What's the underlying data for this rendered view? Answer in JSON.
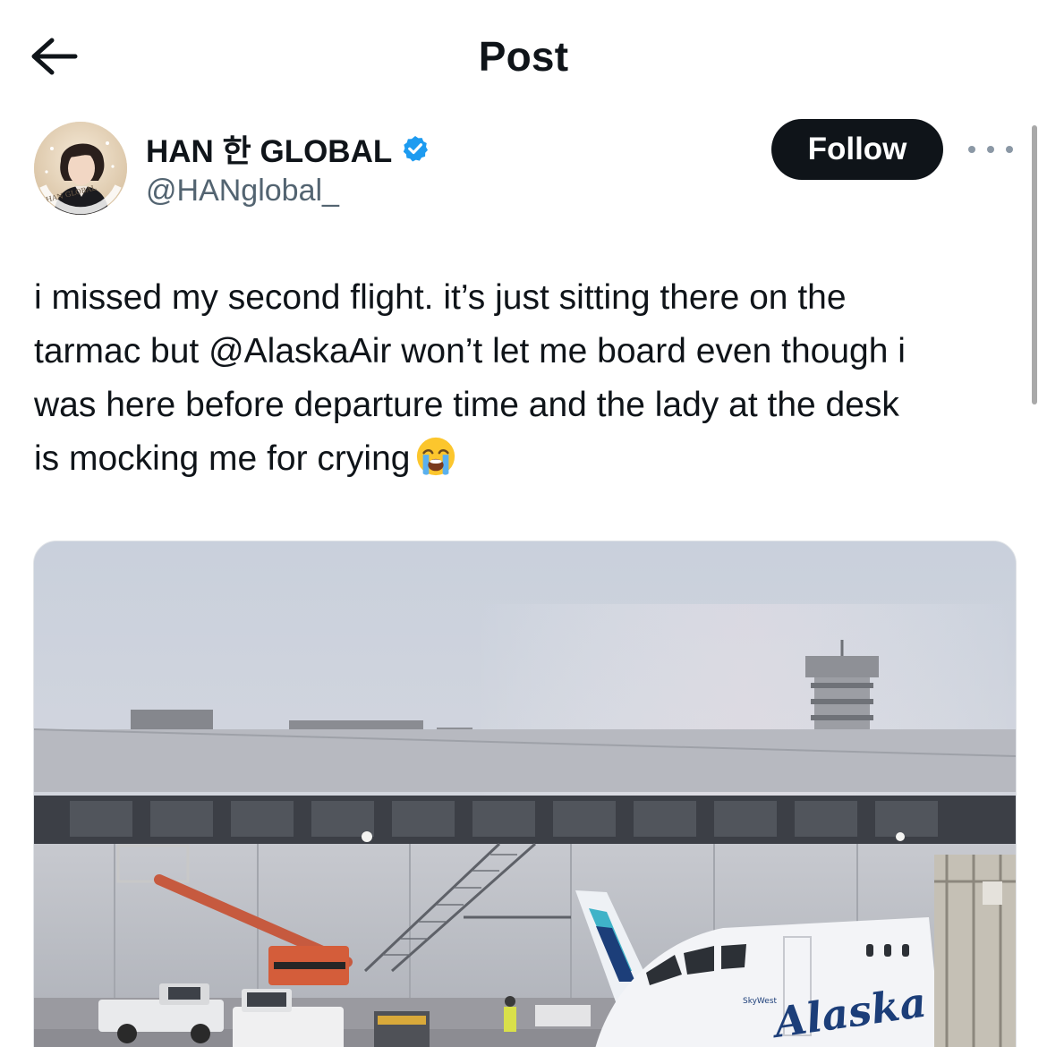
{
  "header": {
    "title": "Post",
    "back_icon": "arrow-left-icon"
  },
  "author": {
    "name": "HAN 한 GLOBAL",
    "handle": "@HANglobal_",
    "verified_icon": "verified-badge-icon",
    "avatar_text": "HAN GLOBAL"
  },
  "actions": {
    "follow_label": "Follow",
    "more_icon": "more-dots-icon"
  },
  "tweet": {
    "line1": "i missed my second flight. it’s just sitting there on the",
    "line2": "tarmac but @AlaskaAir won’t let me board even though i",
    "line3": "was here before departure time and the lady at the desk",
    "line4": "is mocking me for crying",
    "emoji": "loudly-crying-face-icon"
  },
  "media": {
    "plane_livery": "Alaska",
    "plane_small_text": "SkyWest"
  },
  "colors": {
    "text": "#0f1419",
    "secondary": "#536471",
    "verified": "#1d9bf0",
    "follow_bg": "#0f1419"
  }
}
